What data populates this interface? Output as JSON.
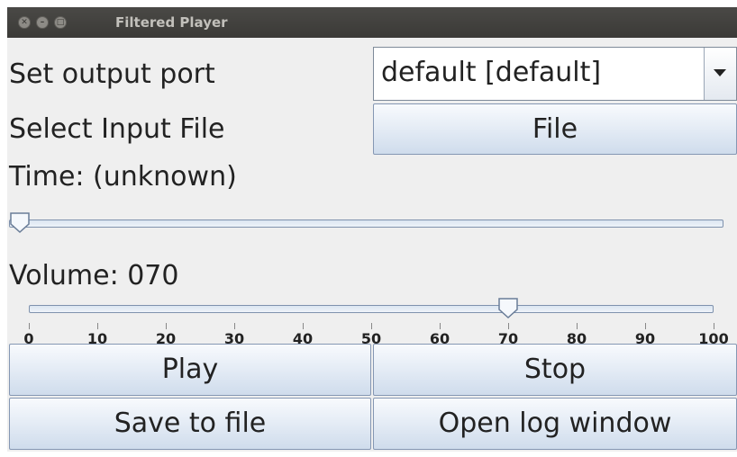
{
  "window": {
    "title": "Filtered Player"
  },
  "output_port": {
    "label": "Set output port",
    "selected": "default [default]"
  },
  "input_file": {
    "label": "Select Input File",
    "button": "File"
  },
  "time": {
    "label": "Time: (unknown)",
    "position_fraction": 0.0
  },
  "volume": {
    "label": "Volume: 070",
    "value": 70,
    "min": 0,
    "max": 100,
    "ticks": [
      "0",
      "10",
      "20",
      "30",
      "40",
      "50",
      "60",
      "70",
      "80",
      "90",
      "100"
    ]
  },
  "buttons": {
    "play": "Play",
    "stop": "Stop",
    "save": "Save to file",
    "log": "Open log window"
  },
  "icons": {
    "close": "close-icon",
    "minimize": "minimize-icon",
    "maximize": "maximize-icon",
    "dropdown": "chevron-down-icon"
  }
}
